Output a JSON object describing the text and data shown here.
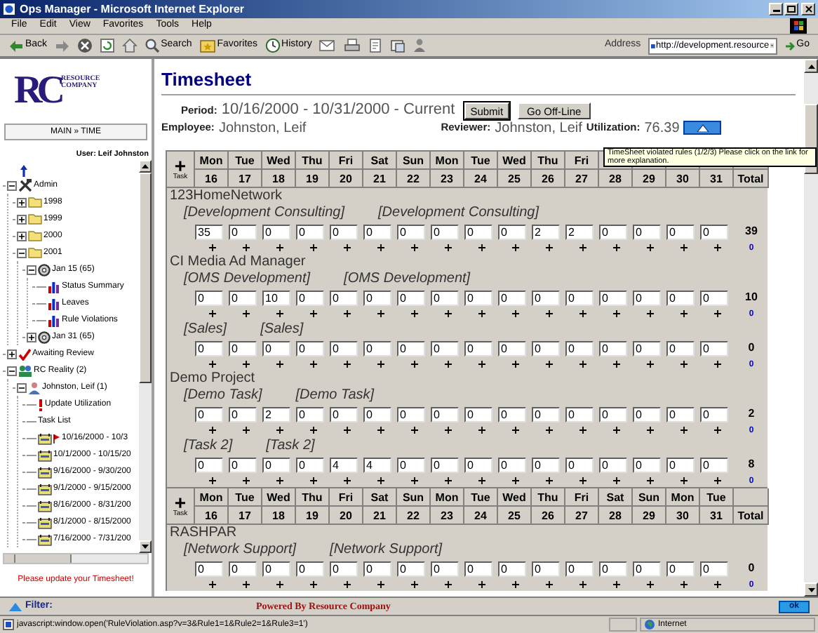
{
  "window": {
    "title": "Ops Manager - Microsoft Internet Explorer"
  },
  "menu": [
    "File",
    "Edit",
    "View",
    "Favorites",
    "Tools",
    "Help"
  ],
  "toolbar": [
    {
      "kind": "back",
      "label": "Back"
    },
    {
      "kind": "forward"
    },
    {
      "kind": "stop"
    },
    {
      "kind": "refresh"
    },
    {
      "kind": "home"
    },
    {
      "kind": "search",
      "label": "Search"
    },
    {
      "kind": "favorites",
      "label": "Favorites"
    },
    {
      "kind": "history",
      "label": "History"
    },
    {
      "kind": "mail"
    },
    {
      "kind": "print"
    },
    {
      "kind": "edit"
    },
    {
      "kind": "discuss"
    },
    {
      "kind": "messenger"
    }
  ],
  "address": {
    "label": "Address",
    "value": "http://development.resource",
    "go": "Go"
  },
  "sidebar": {
    "logo": {
      "letters": "RC",
      "line1": "RESOURCE",
      "line2": "COMPANY"
    },
    "nav_button": "MAIN » TIME",
    "user": "User: Leif Johnston",
    "tree": [
      {
        "kind": "tools",
        "label": "Admin",
        "expanded": true,
        "children": [
          {
            "kind": "folder",
            "label": "1998",
            "expanded": false
          },
          {
            "kind": "folder",
            "label": "1999",
            "expanded": false
          },
          {
            "kind": "folder",
            "label": "2000",
            "expanded": false
          },
          {
            "kind": "folder",
            "label": "2001",
            "expanded": true,
            "children": [
              {
                "kind": "disk",
                "label": "Jan 15 (65)",
                "expanded": true,
                "children": [
                  {
                    "kind": "report",
                    "label": "Status Summary"
                  },
                  {
                    "kind": "report",
                    "label": "Leaves"
                  },
                  {
                    "kind": "report",
                    "label": "Rule Violations"
                  }
                ]
              },
              {
                "kind": "disk",
                "label": "Jan 31 (65)",
                "expanded": false
              }
            ]
          }
        ]
      },
      {
        "kind": "review",
        "label": "Awaiting Review",
        "expanded": false
      },
      {
        "kind": "team",
        "label": "RC Reality (2)",
        "expanded": true,
        "children": [
          {
            "kind": "person",
            "label": "Johnston, Leif (1)",
            "expanded": true,
            "children": [
              {
                "kind": "alert",
                "label": "Update Utilization"
              },
              {
                "kind": "text",
                "label": "Task List"
              },
              {
                "kind": "period",
                "label": "10/16/2000 - 10/3",
                "flagged": true
              },
              {
                "kind": "period",
                "label": "10/1/2000 - 10/15/20",
                "flagged": false
              },
              {
                "kind": "period",
                "label": "9/16/2000 - 9/30/200",
                "flagged": false
              },
              {
                "kind": "period",
                "label": "9/1/2000 - 9/15/2000",
                "flagged": false
              },
              {
                "kind": "period",
                "label": "8/16/2000 - 8/31/200",
                "flagged": false
              },
              {
                "kind": "period",
                "label": "8/1/2000 - 8/15/2000",
                "flagged": false
              },
              {
                "kind": "period",
                "label": "7/16/2000 - 7/31/200",
                "flagged": false
              }
            ]
          }
        ]
      }
    ],
    "message": "Please update your Timesheet!"
  },
  "main": {
    "title": "Timesheet",
    "period_label": "Period:",
    "period": "10/16/2000 - 10/31/2000 - Current",
    "submit": "Submit",
    "offline": "Go Off-Line",
    "employee_label": "Employee:",
    "employee": "Johnston, Leif",
    "reviewer_label": "Reviewer:",
    "reviewer": "Johnston, Leif",
    "utilization_label": "Utilization:",
    "utilization": "76.39",
    "tooltip": "TimeSheet violated rules (1/2/3) Please click on the link for more explanation.",
    "sections": [
      {
        "kind": "header",
        "add": "+",
        "add_label": "Task",
        "total": "Total",
        "days": [
          {
            "day": "Mon",
            "date": "16"
          },
          {
            "day": "Tue",
            "date": "17"
          },
          {
            "day": "Wed",
            "date": "18"
          },
          {
            "day": "Thu",
            "date": "19"
          },
          {
            "day": "Fri",
            "date": "20"
          },
          {
            "day": "Sat",
            "date": "21"
          },
          {
            "day": "Sun",
            "date": "22"
          },
          {
            "day": "Mon",
            "date": "23"
          },
          {
            "day": "Tue",
            "date": "24"
          },
          {
            "day": "Wed",
            "date": "25"
          },
          {
            "day": "Thu",
            "date": "26"
          },
          {
            "day": "Fri",
            "date": "27"
          },
          {
            "date": "28"
          },
          {
            "date": "29"
          },
          {
            "date": "30"
          },
          {
            "date": "31"
          }
        ]
      },
      {
        "kind": "project",
        "name": "123HomeNetwork",
        "tasks": [
          {
            "labels": [
              "[Development Consulting]",
              "[Development Consulting]"
            ],
            "hours": [
              "35",
              "0",
              "0",
              "0",
              "0",
              "0",
              "0",
              "0",
              "0",
              "0",
              "2",
              "2",
              "0",
              "0",
              "0",
              "0"
            ],
            "total": "39",
            "link": "0"
          }
        ]
      },
      {
        "kind": "project",
        "name": "CI Media Ad Manager",
        "tasks": [
          {
            "labels": [
              "[OMS Development]",
              "[OMS Development]"
            ],
            "hours": [
              "0",
              "0",
              "10",
              "0",
              "0",
              "0",
              "0",
              "0",
              "0",
              "0",
              "0",
              "0",
              "0",
              "0",
              "0",
              "0"
            ],
            "total": "10",
            "link": "0"
          },
          {
            "labels": [
              "[Sales]",
              "[Sales]"
            ],
            "hours": [
              "0",
              "0",
              "0",
              "0",
              "0",
              "0",
              "0",
              "0",
              "0",
              "0",
              "0",
              "0",
              "0",
              "0",
              "0",
              "0"
            ],
            "total": "0",
            "link": "0"
          }
        ]
      },
      {
        "kind": "project",
        "name": "Demo Project",
        "tasks": [
          {
            "labels": [
              "[Demo Task]",
              "[Demo Task]"
            ],
            "hours": [
              "0",
              "0",
              "2",
              "0",
              "0",
              "0",
              "0",
              "0",
              "0",
              "0",
              "0",
              "0",
              "0",
              "0",
              "0",
              "0"
            ],
            "total": "2",
            "link": "0"
          },
          {
            "labels": [
              "[Task 2]",
              "[Task 2]"
            ],
            "hours": [
              "0",
              "0",
              "0",
              "0",
              "4",
              "4",
              "0",
              "0",
              "0",
              "0",
              "0",
              "0",
              "0",
              "0",
              "0",
              "0"
            ],
            "total": "8",
            "link": "0"
          }
        ]
      },
      {
        "kind": "header",
        "add": "+",
        "add_label": "Task",
        "total": "Total",
        "days": [
          {
            "day": "Mon",
            "date": "16"
          },
          {
            "day": "Tue",
            "date": "17"
          },
          {
            "day": "Wed",
            "date": "18"
          },
          {
            "day": "Thu",
            "date": "19"
          },
          {
            "day": "Fri",
            "date": "20"
          },
          {
            "day": "Sat",
            "date": "21"
          },
          {
            "day": "Sun",
            "date": "22"
          },
          {
            "day": "Mon",
            "date": "23"
          },
          {
            "day": "Tue",
            "date": "24"
          },
          {
            "day": "Wed",
            "date": "25"
          },
          {
            "day": "Thu",
            "date": "26"
          },
          {
            "day": "Fri",
            "date": "27"
          },
          {
            "day": "Sat",
            "date": "28"
          },
          {
            "day": "Sun",
            "date": "29"
          },
          {
            "day": "Mon",
            "date": "30"
          },
          {
            "day": "Tue",
            "date": "31"
          }
        ]
      },
      {
        "kind": "project",
        "name": "RASHPAR",
        "tasks": [
          {
            "labels": [
              "[Network Support]",
              "[Network Support]"
            ],
            "hours": [
              "0",
              "0",
              "0",
              "0",
              "0",
              "0",
              "0",
              "0",
              "0",
              "0",
              "0",
              "0",
              "0",
              "0",
              "0",
              "0"
            ],
            "total": "0",
            "link": "0"
          }
        ]
      }
    ]
  },
  "footer": {
    "filter": "Filter:",
    "powered": "Powered By Resource Company",
    "ok": "ok"
  },
  "status_bar": {
    "text": "javascript:window.open('RuleViolation.asp?v=3&Rule1=1&Rule2=1&Rule3=1')",
    "zone": "Internet"
  }
}
